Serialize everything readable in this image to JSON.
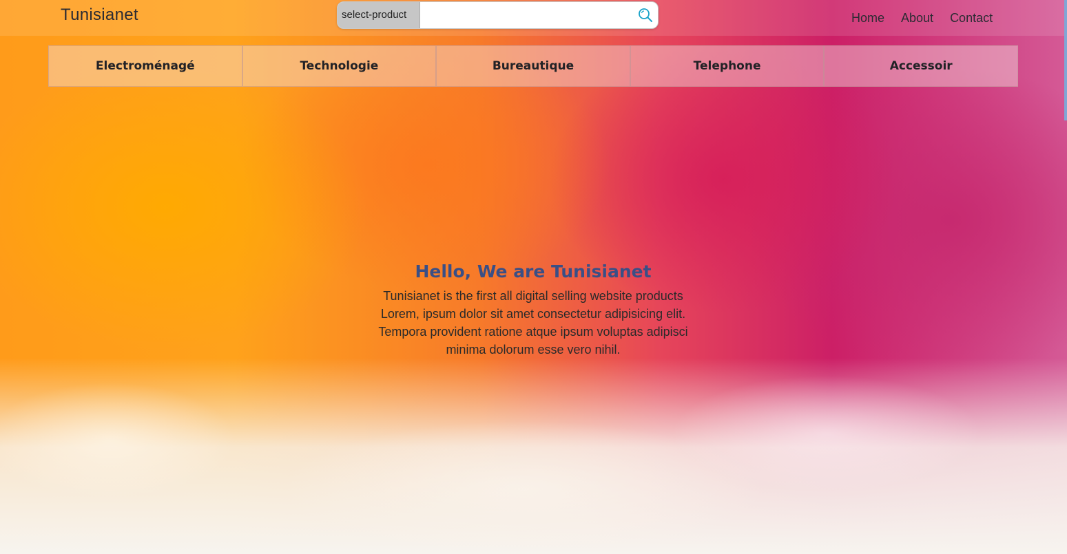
{
  "header": {
    "brand": "Tunisianet",
    "search": {
      "select_label": "select-product",
      "placeholder": "",
      "icon": "search-icon"
    },
    "nav": [
      {
        "label": "Home"
      },
      {
        "label": "About"
      },
      {
        "label": "Contact"
      }
    ]
  },
  "categories": [
    {
      "label": "Electroménagé"
    },
    {
      "label": "Technologie"
    },
    {
      "label": "Bureautique"
    },
    {
      "label": "Telephone"
    },
    {
      "label": "Accessoir"
    }
  ],
  "hero": {
    "title": "Hello, We are Tunisianet",
    "lines": [
      "Tunisianet is the first all digital selling website products",
      "Lorem, ipsum dolor sit amet consectetur adipisicing elit.",
      "Tempora provident ratione atque ipsum voluptas adipisci",
      "minima dolorum esse vero nihil."
    ]
  },
  "colors": {
    "accent_title": "#3a4f86",
    "search_icon": "#1aa3c9"
  }
}
